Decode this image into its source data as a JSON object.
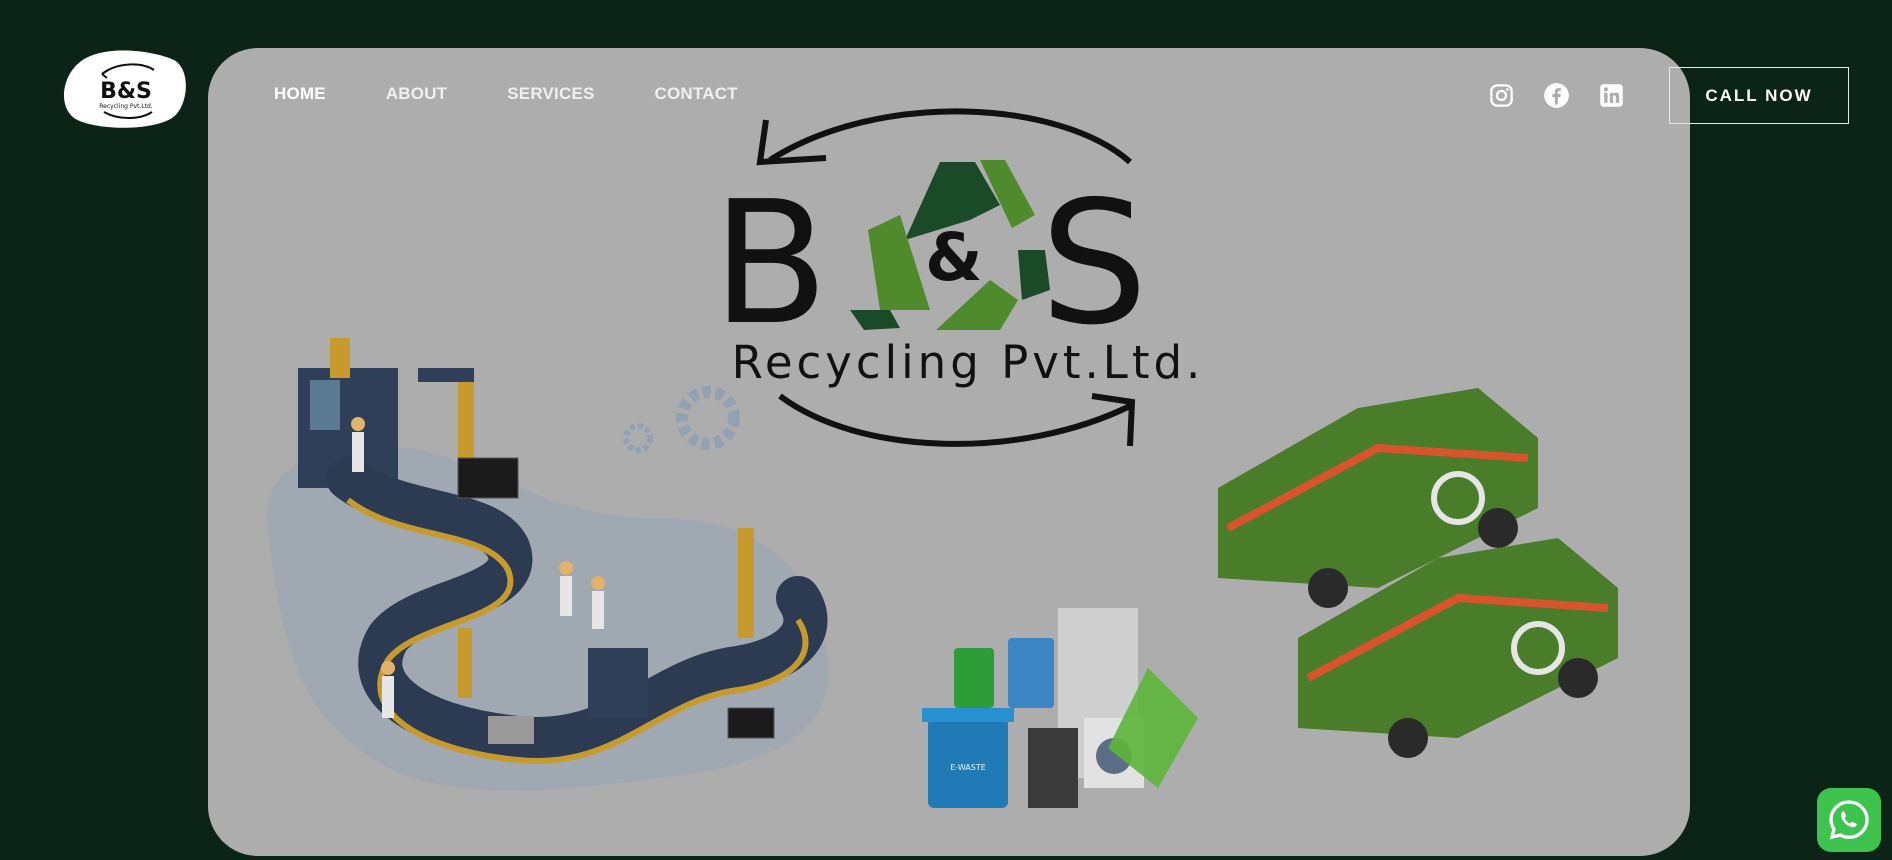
{
  "brand": {
    "logo_text": "B&S",
    "logo_tagline": "Recycling Pvt.Ltd.",
    "title_left": "B",
    "title_amp": "&",
    "title_right": "S",
    "subtitle": "Recycling Pvt.Ltd."
  },
  "nav": {
    "items": [
      {
        "label": "HOME",
        "active": true
      },
      {
        "label": "ABOUT",
        "active": false
      },
      {
        "label": "SERVICES",
        "active": false
      },
      {
        "label": "CONTACT",
        "active": false
      }
    ]
  },
  "socials": [
    "instagram-icon",
    "facebook-icon",
    "linkedin-icon"
  ],
  "cta": {
    "label": "CALL NOW"
  },
  "bins": {
    "label": "E-WASTE"
  },
  "colors": {
    "page_bg": "#0c2418",
    "hero_bg": "#adadad",
    "recycle_dark": "#1b4a28",
    "recycle_light": "#4f8a2c",
    "truck_green": "#4a7d2a",
    "whatsapp": "#3ec34f"
  }
}
